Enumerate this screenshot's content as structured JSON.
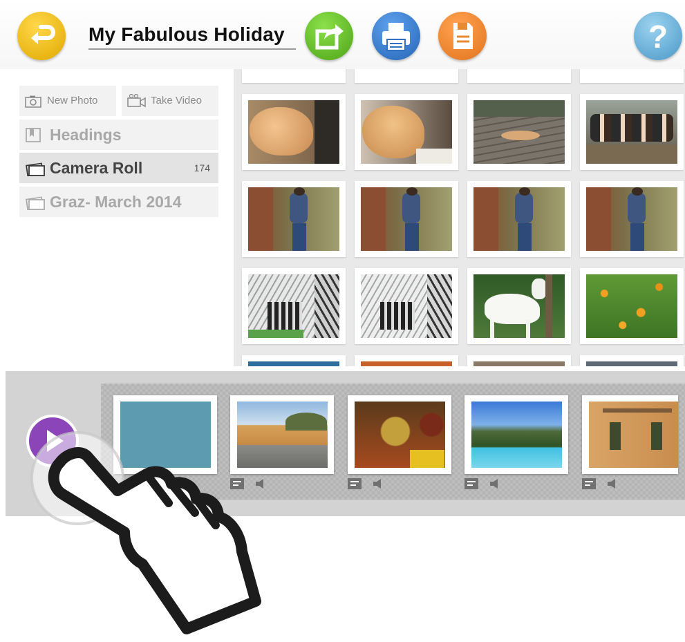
{
  "header": {
    "title": "My Fabulous Holiday",
    "back_icon": "back-arrow-icon",
    "share_icon": "share-icon",
    "print_icon": "printer-icon",
    "save_icon": "save-icon",
    "help_icon": "help-icon",
    "help_glyph": "?"
  },
  "colors": {
    "back": "#f0bf12",
    "share": "#6cc02f",
    "print": "#3f86d6",
    "save": "#ee8a33",
    "help": "#72b6dc",
    "play": "#8b45b8"
  },
  "sidebar": {
    "new_photo": "New Photo",
    "take_video": "Take Video",
    "items": [
      {
        "label": "Headings",
        "count": ""
      },
      {
        "label": "Camera Roll",
        "count": "174"
      },
      {
        "label": "Graz- March 2014",
        "count": ""
      }
    ]
  },
  "slideshow": {
    "play_icon": "play-icon",
    "slide_icons": [
      "caption-icon",
      "audio-icon"
    ]
  },
  "overlay": {
    "hand_icon": "tap-hand-icon"
  }
}
